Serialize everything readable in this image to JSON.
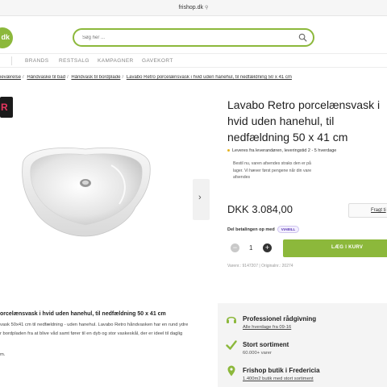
{
  "browser": {
    "url": "frishop.dk"
  },
  "header": {
    "logo_text": "dk",
    "search_placeholder": "Søg her ..."
  },
  "nav": {
    "items": [
      {
        "label": "BRANDS"
      },
      {
        "label": "RESTSALG"
      },
      {
        "label": "KAMPAGNER"
      },
      {
        "label": "GAVEKORT"
      }
    ]
  },
  "breadcrumb": [
    {
      "label": "ieværelse"
    },
    {
      "label": "Håndvaske til bad"
    },
    {
      "label": "Håndvask til bordplade"
    },
    {
      "label": "Lavabo Retro porcelænsvask i hvid uden hanehul, til nedfældning 50 x 41 cm"
    }
  ],
  "product": {
    "badge_letter": "R",
    "title": "Lavabo Retro porcelænsvask i hvid uden hanehul, til nedfældning 50 x 41 cm",
    "stock_text": "Leveres fra leverandøren, leveringstid 2 - 5 hverdage",
    "stock_note": "Bestil nu, varen afsendes straks den er på lager. Vi hæver først pengene når din vare afsendes",
    "price": "DKK 3.084,00",
    "freight_label": "Fragt ti",
    "divide_label": "Del betalingen op med",
    "viabill_label": "VIABILL",
    "quantity": "1",
    "add_to_cart": "LÆG I KURV",
    "sku": "Varenr.: 9147207  |  Originalnr.: 20274"
  },
  "description": {
    "title": "orcelænsvask i hvid uden hanehul, til nedfældning 50 x 41 cm",
    "lines": [
      "vask 50x41 cm til nedfældning - uden hanehul. Lavabo Retro håndvasken har en rund ydre",
      "r bordpladen fra at blive våd samt fører til en dyb og stor vaskeskål, der er ideel til daglig",
      "m."
    ]
  },
  "usps": [
    {
      "icon": "headset-icon",
      "title": "Professionel rådgivning",
      "sub": "Alle hverdage fra 09-16",
      "link": true
    },
    {
      "icon": "checkmark-icon",
      "title": "Stort sortiment",
      "sub": "60.000+ varer",
      "link": false
    },
    {
      "icon": "map-pin-icon",
      "title": "Frishop butik i Fredericia",
      "sub": "1.400m2 butik med stort sortiment",
      "link": true
    }
  ],
  "colors": {
    "brand_green": "#8cb83b",
    "badge_pink": "#e8365f",
    "stock_yellow": "#e5b322"
  }
}
